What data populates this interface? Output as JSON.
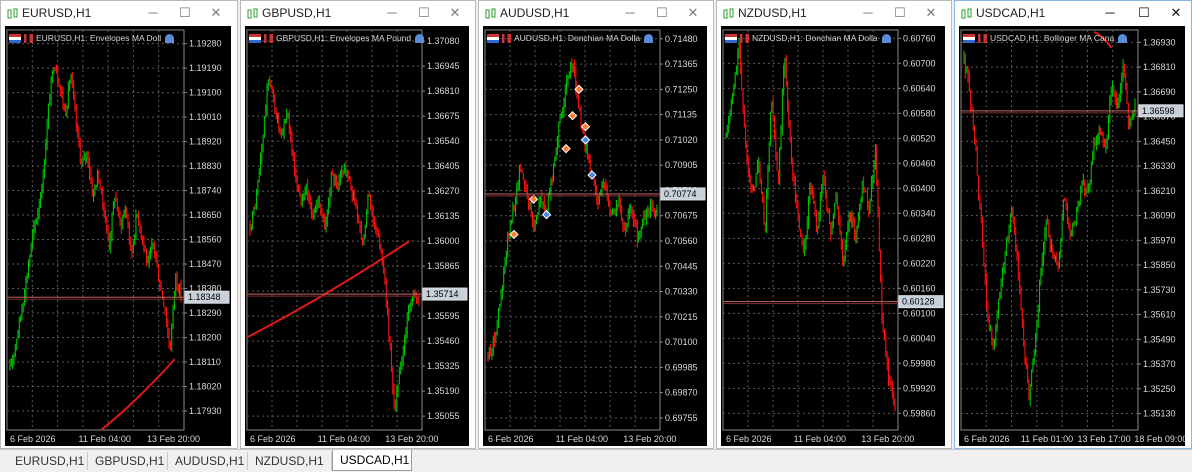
{
  "colors": {
    "up": "#00c000",
    "down": "#ff1010",
    "grid": "#5a5a5a",
    "bid_line": "#c86464",
    "ma": "#e01818",
    "text": "#d8d8d8"
  },
  "windows": [
    {
      "title": "EURUSD,H1",
      "indicator_caption": "EURUSD,H1: Envelopes MA Doll",
      "price_labels": [
        "1.19280",
        "1.19190",
        "1.19100",
        "1.19010",
        "1.18920",
        "1.18830",
        "1.18740",
        "1.18650",
        "1.18560",
        "1.18470",
        "1.18380",
        "1.18290",
        "1.18200",
        "1.18110",
        "1.18020",
        "1.17930"
      ],
      "price_range": [
        1.1786,
        1.1933
      ],
      "current_price": "1.18348",
      "time_labels": [
        "6 Feb 2026",
        "11 Feb 04:00",
        "13 Feb 20:00"
      ],
      "path": [
        1.1808,
        1.1818,
        1.1829,
        1.1842,
        1.1856,
        1.1866,
        1.1879,
        1.1905,
        1.1922,
        1.1913,
        1.1902,
        1.1917,
        1.1898,
        1.1883,
        1.1888,
        1.1872,
        1.188,
        1.1867,
        1.1854,
        1.1873,
        1.1861,
        1.1868,
        1.185,
        1.1866,
        1.1857,
        1.1846,
        1.1855,
        1.1841,
        1.1832,
        1.1815,
        1.1843,
        1.1835
      ],
      "ma": [
        1.1786,
        1.1812
      ]
    },
    {
      "title": "GBPUSD,H1",
      "indicator_caption": "GBPUSD,H1: Envelopes MA Pound",
      "price_labels": [
        "1.37080",
        "1.36945",
        "1.36810",
        "1.36675",
        "1.36540",
        "1.36405",
        "1.36270",
        "1.36135",
        "1.36000",
        "1.35865",
        "1.35730",
        "1.35595",
        "1.35460",
        "1.35325",
        "1.35190",
        "1.35055"
      ],
      "price_range": [
        1.3498,
        1.3714
      ],
      "current_price": "1.35714",
      "time_labels": [
        "6 Feb 2026",
        "11 Feb 04:00",
        "13 Feb 20:00"
      ],
      "path": [
        1.3608,
        1.3622,
        1.3655,
        1.369,
        1.3672,
        1.3655,
        1.3671,
        1.364,
        1.3622,
        1.363,
        1.3612,
        1.3624,
        1.3605,
        1.3636,
        1.3628,
        1.3642,
        1.363,
        1.3618,
        1.36,
        1.3625,
        1.3607,
        1.3595,
        1.356,
        1.3508,
        1.353,
        1.3555,
        1.3572,
        1.3566
      ],
      "ma": [
        1.3548,
        1.36
      ]
    },
    {
      "title": "AUDUSD,H1",
      "indicator_caption": "AUDUSD,H1: Donchian MA Dolla",
      "price_labels": [
        "0.71480",
        "0.71365",
        "0.71250",
        "0.71135",
        "0.71020",
        "0.70905",
        "0.70790",
        "0.70675",
        "0.70560",
        "0.70445",
        "0.70330",
        "0.70215",
        "0.70100",
        "0.69985",
        "0.69870",
        "0.69755"
      ],
      "price_range": [
        0.697,
        0.7152
      ],
      "current_price": "0.70774",
      "time_labels": [
        "6 Feb 2026",
        "11 Feb 04:00",
        "13 Feb 20:00"
      ],
      "path": [
        0.7003,
        0.7012,
        0.703,
        0.7055,
        0.7072,
        0.709,
        0.7078,
        0.7062,
        0.7075,
        0.7069,
        0.7088,
        0.711,
        0.7125,
        0.7138,
        0.7115,
        0.7098,
        0.7085,
        0.7075,
        0.7082,
        0.7068,
        0.7074,
        0.706,
        0.7071,
        0.7058,
        0.7066,
        0.7072,
        0.7068
      ],
      "markers": [
        [
          4,
          0.7059,
          "d"
        ],
        [
          7,
          0.7075,
          "d"
        ],
        [
          12,
          0.7098,
          "d"
        ],
        [
          13,
          0.7113,
          "d"
        ],
        [
          14,
          0.7125,
          "d"
        ],
        [
          15,
          0.7108,
          "d"
        ],
        [
          15,
          0.7102,
          "u"
        ],
        [
          16,
          0.7086,
          "u"
        ],
        [
          9,
          0.7068,
          "u"
        ]
      ]
    },
    {
      "title": "NZDUSD,H1",
      "indicator_caption": "NZDUSD,H1: Donchian MA Dolla",
      "price_labels": [
        "0.60760",
        "0.60700",
        "0.60640",
        "0.60580",
        "0.60520",
        "0.60460",
        "0.60400",
        "0.60340",
        "0.60280",
        "0.60220",
        "0.60160",
        "0.60100",
        "0.60040",
        "0.59980",
        "0.59920",
        "0.59860"
      ],
      "price_range": [
        0.5982,
        0.6078
      ],
      "current_price": "0.60128",
      "time_labels": [
        "6 Feb 2026",
        "11 Feb 04:00",
        "13 Feb 20:00"
      ],
      "path": [
        0.6052,
        0.6062,
        0.6074,
        0.6051,
        0.6038,
        0.6046,
        0.603,
        0.6062,
        0.604,
        0.6072,
        0.6048,
        0.6033,
        0.6024,
        0.6041,
        0.603,
        0.6044,
        0.6029,
        0.6038,
        0.6022,
        0.6034,
        0.6028,
        0.6042,
        0.6035,
        0.605,
        0.6008,
        0.5994,
        0.5988
      ],
      "ma": null
    },
    {
      "title": "USDCAD,H1",
      "indicator_caption": "USDCAD,H1: Bollinger MA Cana",
      "price_labels": [
        "1.36930",
        "1.36810",
        "1.36690",
        "1.36570",
        "1.36450",
        "1.36330",
        "1.36210",
        "1.36090",
        "1.35970",
        "1.35850",
        "1.35730",
        "1.35610",
        "1.35490",
        "1.35370",
        "1.35250",
        "1.35130"
      ],
      "price_range": [
        1.3505,
        1.3699
      ],
      "current_price": "1.36598",
      "time_labels": [
        "6 Feb 2026",
        "11 Feb 01:00",
        "13 Feb 17:00",
        "18 Feb 09:00"
      ],
      "path": [
        1.3685,
        1.3668,
        1.364,
        1.36,
        1.356,
        1.3545,
        1.357,
        1.359,
        1.3612,
        1.359,
        1.355,
        1.352,
        1.3545,
        1.358,
        1.3605,
        1.359,
        1.3585,
        1.362,
        1.36,
        1.3608,
        1.3625,
        1.3618,
        1.3642,
        1.365,
        1.364,
        1.3672,
        1.366,
        1.3684,
        1.3652,
        1.3664
      ],
      "ma": [
        1.3685,
        1.3692
      ]
    }
  ],
  "tabs": [
    "EURUSD,H1",
    "GBPUSD,H1",
    "AUDUSD,H1",
    "NZDUSD,H1",
    "USDCAD,H1"
  ],
  "active_tab": 4,
  "active_window": 4
}
